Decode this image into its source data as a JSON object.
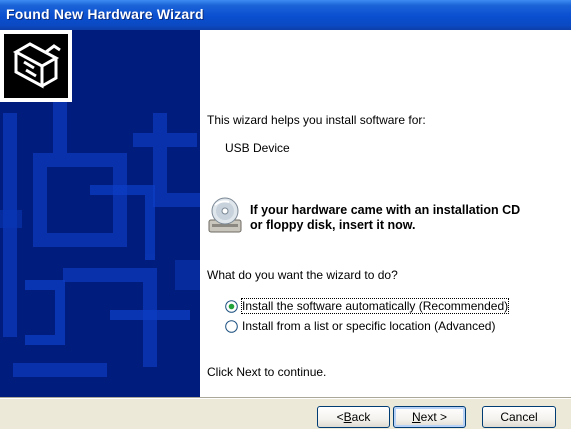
{
  "window": {
    "title": "Found New Hardware Wizard"
  },
  "content": {
    "intro": "This wizard helps you install software for:",
    "device_name": "USB Device",
    "cd_prompt_line1": "If your hardware came with an installation CD",
    "cd_prompt_line2": "or floppy disk, insert it now.",
    "question": "What do you want the wizard to do?",
    "options": [
      {
        "label": "Install the software automatically (Recommended)",
        "selected": true
      },
      {
        "label": "Install from a list or specific location (Advanced)",
        "selected": false
      }
    ],
    "continue_hint": "Click Next to continue."
  },
  "buttons": {
    "back": {
      "pre": "< ",
      "accel": "B",
      "rest": "ack"
    },
    "next": {
      "pre": "",
      "accel": "N",
      "rest": "ext >"
    },
    "cancel": "Cancel"
  },
  "colors": {
    "title_bar": "#0a4fd0",
    "side_panel": "#001d7e",
    "dialog_face": "#ece9d8",
    "accent": "#003c74"
  },
  "icons": {
    "hardware": "hardware-icon",
    "cd": "cd-icon"
  }
}
